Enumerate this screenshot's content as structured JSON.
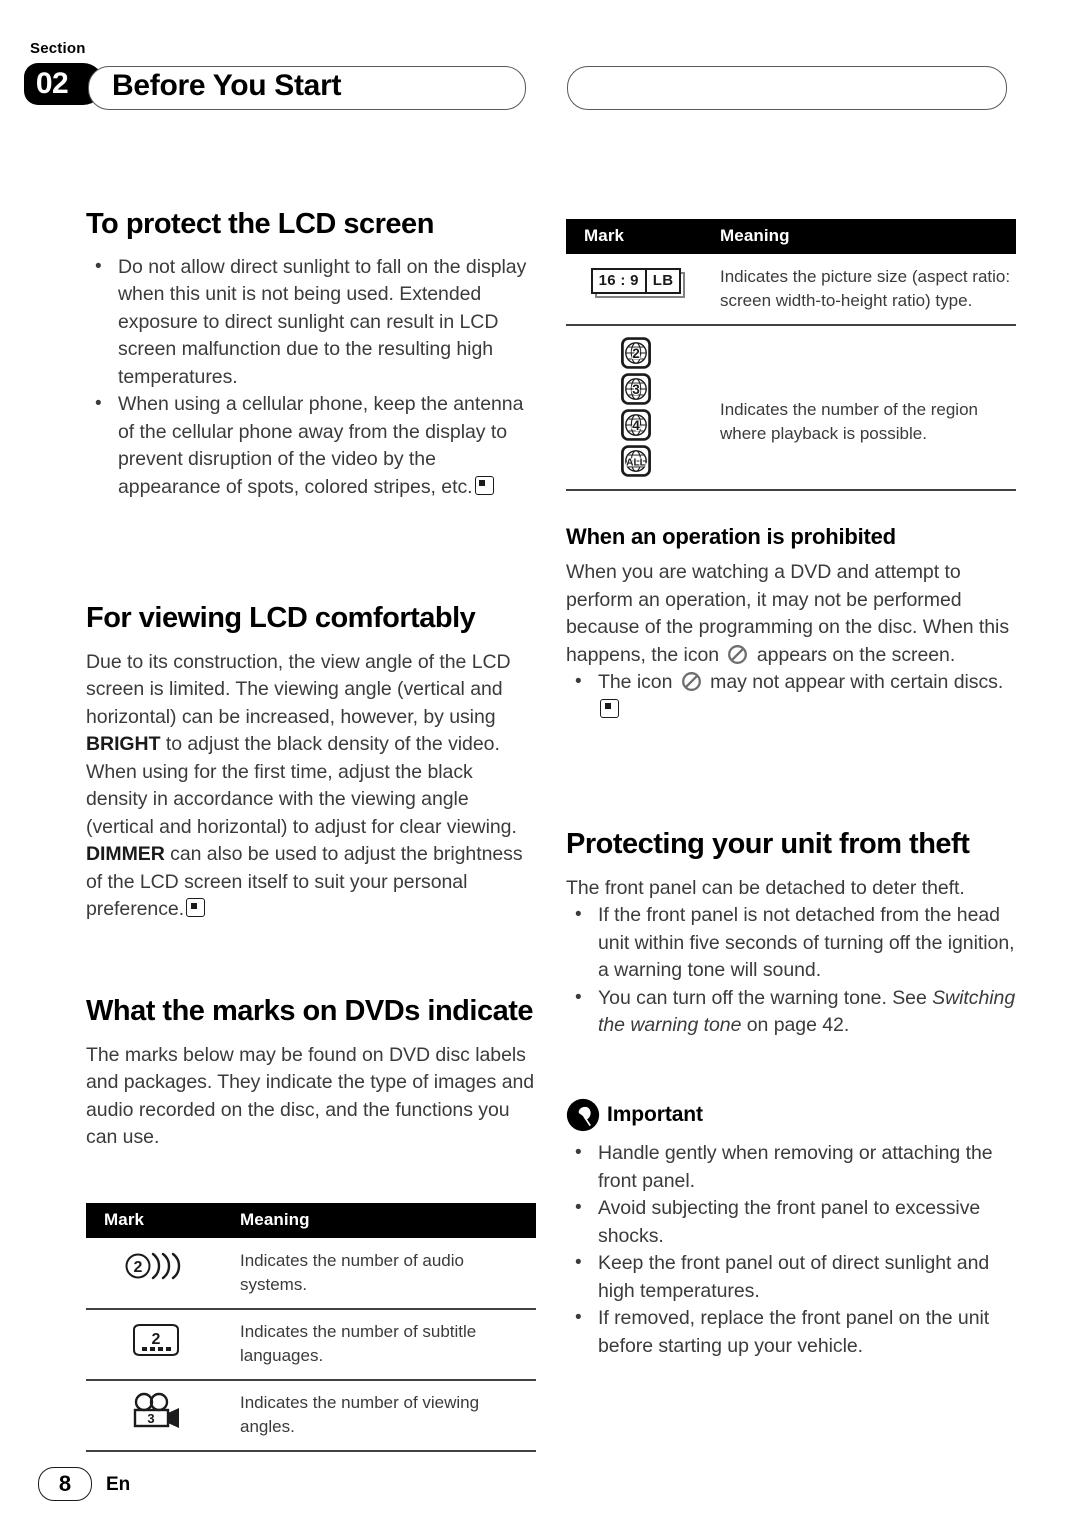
{
  "header": {
    "section_word": "Section",
    "section_number": "02",
    "title": "Before You Start"
  },
  "left_column": {
    "sections": [
      {
        "heading": "To protect the LCD screen",
        "bullets": [
          "Do not allow direct sunlight to fall on the display when this unit is not being used. Extended exposure to direct sunlight can result in LCD screen malfunction due to the resulting high temperatures.",
          "When using a cellular phone, keep the antenna of the cellular phone away from the display to prevent disruption of the video by the appearance of spots, colored stripes, etc."
        ]
      },
      {
        "heading": "For viewing LCD comfortably",
        "paragraph_part_1": "Due to its construction, the view angle of the LCD screen is limited. The viewing angle (vertical and horizontal) can be increased, however, by using ",
        "keyword_1": "BRIGHT",
        "paragraph_part_2": " to adjust the black density of the video. When using for the first time, adjust the black density in accordance with the viewing angle (vertical and horizontal) to adjust for clear viewing. ",
        "keyword_2": "DIMMER",
        "paragraph_part_3": " can also be used to adjust the brightness of the LCD screen itself to suit your personal preference."
      },
      {
        "heading": "What the marks on DVDs indicate",
        "paragraph": "The marks below may be found on DVD disc labels and packages. They indicate the type of images and audio recorded on the disc, and the functions you can use."
      }
    ],
    "table": {
      "columns": [
        "Mark",
        "Meaning"
      ],
      "rows": [
        {
          "mark_icon": "audio-systems-mark-icon",
          "mark_value": "2",
          "meaning": "Indicates the number of audio systems."
        },
        {
          "mark_icon": "subtitle-languages-mark-icon",
          "mark_value": "2",
          "meaning": "Indicates the number of subtitle languages."
        },
        {
          "mark_icon": "viewing-angles-mark-icon",
          "mark_value": "3",
          "meaning": "Indicates the number of viewing angles."
        }
      ]
    }
  },
  "right_column": {
    "table": {
      "columns": [
        "Mark",
        "Meaning"
      ],
      "rows": [
        {
          "mark_icon": "aspect-ratio-mark-icon",
          "mark_values": [
            "16 : 9",
            "LB"
          ],
          "meaning": "Indicates the picture size (aspect ratio: screen width-to-height ratio) type."
        },
        {
          "mark_icon": "region-code-mark-icon",
          "mark_values": [
            "2",
            "3",
            "4",
            "ALL"
          ],
          "meaning": "Indicates the number of the region where playback is possible."
        }
      ]
    },
    "sections": [
      {
        "heading": "When an operation is prohibited",
        "paragraph_part_1": "When you are watching a DVD and attempt to perform an operation, it may not be performed because of the programming on the disc. When this happens, the icon ",
        "paragraph_part_2": " appears on the screen.",
        "bullet_part_1": "The icon ",
        "bullet_part_2": " may not appear with certain discs."
      },
      {
        "heading": "Protecting your unit from theft",
        "paragraph": "The front panel can be detached to deter theft.",
        "bullets": [
          "If the front panel is not detached from the head unit within five seconds of turning off the ignition, a warning tone will sound."
        ],
        "bullet_ref_part_1": "You can turn off the warning tone. See ",
        "bullet_ref_italic": "Switching the warning tone",
        "bullet_ref_part_2": " on page 42."
      }
    ],
    "important": {
      "label": "Important",
      "icon": "pushpin-icon",
      "bullets": [
        "Handle gently when removing or attaching the front panel.",
        "Avoid subjecting the front panel to excessive shocks.",
        "Keep the front panel out of direct sunlight and high temperatures.",
        "If removed, replace the front panel on the unit before starting up your vehicle."
      ]
    }
  },
  "footer": {
    "page_number": "8",
    "language": "En"
  },
  "colors": {
    "ink": "#231f20",
    "body_text": "#3b3b3d",
    "rule": "#414042",
    "header_bar": "#000000",
    "pill_border": "#58595b"
  }
}
